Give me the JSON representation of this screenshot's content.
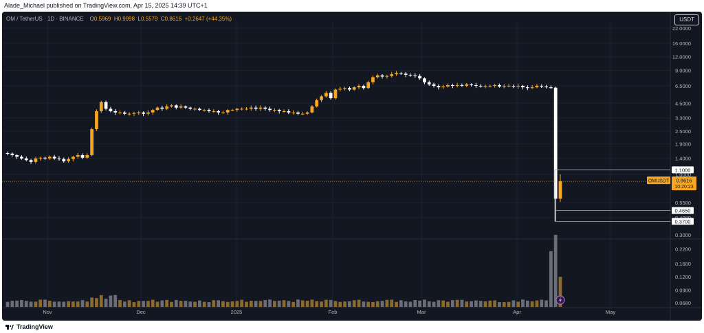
{
  "header": {
    "publisher_text": "Alade_Michael published on TradingView.com, Apr 15, 2025 14:39 UTC+1"
  },
  "footer": {
    "brand": "TradingView"
  },
  "legend": {
    "symbol": "OM / TetherUS · 1D · BINANCE",
    "open_label": "O",
    "open": "0.5969",
    "high_label": "H",
    "high": "0.9998",
    "low_label": "L",
    "low": "0.5579",
    "close_label": "C",
    "close": "0.8616",
    "change": "+0.2647 (+44.35%)"
  },
  "currency_button": "USDT",
  "price_tag": {
    "symbol": "OMUSDT",
    "price": "0.8616",
    "countdown": "10:20:23"
  },
  "colors": {
    "background": "#131722",
    "up": "#f5a623",
    "down": "#ffffff",
    "text": "#b2b5be",
    "grid": "#1e222d"
  },
  "chart_data": {
    "type": "candlestick",
    "scale": "log",
    "y_ticks": [
      "22.0000",
      "16.0000",
      "12.0000",
      "9.0000",
      "6.5000",
      "4.5000",
      "3.3000",
      "2.5000",
      "1.9000",
      "1.4000",
      "1.0000",
      "0.5500",
      "0.4000"
    ],
    "volume_ticks": [
      "0.3000",
      "0.2200",
      "0.1600",
      "0.1200",
      "0.0900",
      "0.0680"
    ],
    "x_labels": [
      "Nov",
      "Dec",
      "2025",
      "Feb",
      "Mar",
      "Apr",
      "May"
    ],
    "labeled_levels": [
      {
        "label": "1.1000"
      },
      {
        "label": "0.4650"
      },
      {
        "label": "0.3700"
      }
    ],
    "last_price": 0.8616,
    "approx_closes": [
      1.55,
      1.5,
      1.45,
      1.4,
      1.35,
      1.3,
      1.4,
      1.42,
      1.4,
      1.45,
      1.4,
      1.38,
      1.32,
      1.38,
      1.45,
      1.5,
      1.42,
      1.5,
      2.6,
      3.8,
      4.6,
      4.0,
      3.8,
      3.7,
      3.7,
      3.6,
      3.6,
      3.65,
      3.7,
      3.6,
      3.7,
      3.9,
      4.1,
      4.0,
      4.2,
      4.3,
      4.1,
      4.2,
      4.1,
      4.0,
      4.0,
      3.9,
      3.9,
      3.8,
      3.8,
      3.7,
      3.7,
      3.9,
      3.9,
      4.0,
      4.0,
      4.0,
      4.1,
      4.0,
      4.1,
      4.0,
      3.9,
      3.9,
      3.8,
      3.8,
      3.7,
      3.7,
      3.6,
      3.6,
      3.7,
      4.2,
      4.8,
      5.2,
      5.6,
      5.0,
      6.0,
      6.1,
      6.2,
      6.0,
      6.3,
      6.5,
      6.2,
      7.0,
      7.8,
      8.1,
      7.9,
      8.0,
      8.3,
      8.5,
      8.4,
      8.2,
      8.1,
      8.0,
      7.6,
      7.0,
      6.7,
      6.5,
      6.3,
      6.4,
      6.6,
      6.5,
      6.6,
      6.5,
      6.7,
      6.6,
      6.5,
      6.4,
      6.5,
      6.5,
      6.6,
      6.4,
      6.5,
      6.5,
      6.4,
      6.5,
      6.3,
      6.2,
      6.3,
      6.5,
      6.4,
      6.3,
      6.2,
      0.5969,
      0.8616
    ]
  }
}
